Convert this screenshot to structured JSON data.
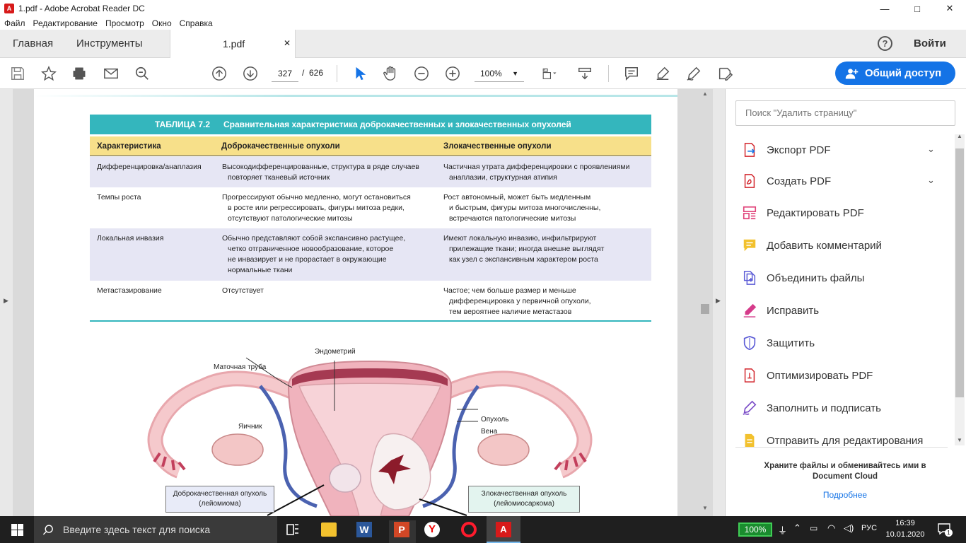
{
  "window": {
    "title": "1.pdf - Adobe Acrobat Reader DC",
    "minimize": "—",
    "maximize": "□",
    "close": "✕"
  },
  "menu": [
    "Файл",
    "Редактирование",
    "Просмотр",
    "Окно",
    "Справка"
  ],
  "tabs": {
    "home": "Главная",
    "tools": "Инструменты",
    "doc": "1.pdf",
    "doc_close": "✕",
    "help": "?",
    "signin": "Войти"
  },
  "toolbar": {
    "page_current": "327",
    "page_sep": "/",
    "page_total": "626",
    "zoom": "100%",
    "share": "Общий доступ"
  },
  "pdf": {
    "table_number": "ТАБЛИЦА 7.2",
    "table_title": "Сравнительная характеристика доброкачественных и злокачественных опухолей",
    "headers": [
      "Характеристика",
      "Доброкачественные опухоли",
      "Злокачественные опухоли"
    ],
    "rows": [
      {
        "c1": "Дифференцировка/анаплазия",
        "c2": [
          "Высокодифференцированные, структура в ряде случаев",
          "повторяет тканевый источник"
        ],
        "c3": [
          "Частичная утрата дифференцировки с проявлениями",
          "анаплазии, структурная атипия"
        ]
      },
      {
        "c1": "Темпы роста",
        "c2": [
          "Прогрессируют обычно медленно, могут остановиться",
          "в росте или регрессировать, фигуры митоза редки,",
          "отсутствуют патологические митозы"
        ],
        "c3": [
          "Рост автономный, может быть медленным",
          "и быстрым, фигуры митоза многочисленны,",
          "встречаются патологические митозы"
        ]
      },
      {
        "c1": "Локальная инвазия",
        "c2": [
          "Обычно представляют собой экспансивно растущее,",
          "четко отграниченное новообразование, которое",
          "не инвазирует и не прорастает в окружающие",
          "нормальные ткани"
        ],
        "c3": [
          "Имеют локальную инвазию, инфильтрируют",
          "прилежащие ткани; иногда внешне выглядят",
          "как узел с экспансивным характером роста"
        ]
      },
      {
        "c1": "Метастазирование",
        "c2": [
          "Отсутствует"
        ],
        "c3": [
          "Частое; чем больше размер и меньше",
          "дифференцировка у первичной опухоли,",
          "тем вероятнее наличие метастазов"
        ]
      }
    ],
    "figure": {
      "endometrium": "Эндометрий",
      "tube": "Маточная труба",
      "ovary": "Яичник",
      "tumor": "Опухоль",
      "vein": "Вена",
      "benign": [
        "Доброкачественная опухоль",
        "(лейомиома)"
      ],
      "malignant": [
        "Злокачественная опухоль",
        "(лейомиосаркома)"
      ]
    }
  },
  "rightpanel": {
    "search_placeholder": "Поиск \"Удалить страницу\"",
    "tools": [
      "Экспорт PDF",
      "Создать PDF",
      "Редактировать PDF",
      "Добавить комментарий",
      "Объединить файлы",
      "Исправить",
      "Защитить",
      "Оптимизировать PDF",
      "Заполнить и подписать",
      "Отправить для редактирования"
    ],
    "promo": [
      "Храните файлы и обменивайтесь ими в",
      "Document Cloud"
    ],
    "more": "Подробнее"
  },
  "taskbar": {
    "search": "Введите здесь текст для поиска",
    "battery": "100%",
    "lang": "РУС",
    "time": "16:39",
    "date": "10.01.2020",
    "notif": "1"
  },
  "colors": {
    "accent": "#1473e6",
    "teal": "#34b6bd",
    "header_yellow": "#f7e08a",
    "row_lavender": "#e6e6f4"
  }
}
